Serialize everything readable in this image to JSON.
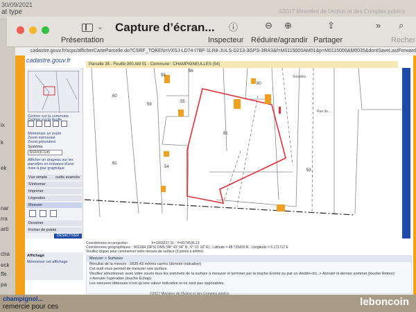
{
  "background": {
    "top_left_text": "30/09/2021",
    "top_left_text2": "at type",
    "top_right_text": "©2017 Ministère de l'Action et des Comptes publics",
    "left_strip_fragments": [
      "ix",
      "k",
      "ek",
      "nar",
      "rra",
      "arti",
      "cha",
      "eck",
      "ffe",
      "pa"
    ],
    "bottom_text": "remercie pour ces",
    "bottom_bold": "champignol..."
  },
  "watermark": "leboncoin",
  "window": {
    "title": "Capture d’écran...",
    "toolbar": {
      "presentation": "Présentation",
      "inspecteur": "Inspecteur",
      "reduire": "Réduire/agrandir",
      "partager": "Partager",
      "recherche": "Recherc"
    }
  },
  "browser": {
    "url": "cadastre.gouv.fr/scpc/afficherCarteParcelle.do?CSRF_TOKEN=VXSJ-LD74-I7BF-1LR8-JULS-D213-3GPS-3RA3&f=M0115000AM01&p=M0115000AM0035&dontSaveLastForward&keep"
  },
  "site": {
    "logo": "cadastre.gouv.fr",
    "parcel_header": "Parcelle 35 - Feuille 000 AM 01 - Commune : CHAMPIGNEULLES (54)",
    "left_panel": {
      "links": [
        "Centrer sur la commune",
        "Centrer sur la feuille"
      ],
      "zoom_links": [
        "Mémoriser ce zoom",
        "Zoom mémorisé",
        "Zoom précédent"
      ],
      "system_label": "Système",
      "system_value": "RGF93CC49",
      "checkbox_label": "Afficher un drapeau sur les parcelles en instance d'une mise à jour graphique",
      "vue_label": "Vue simple",
      "vue_right": "outils avancés",
      "sections": [
        "S'informer",
        "Imprimer",
        "Légendes",
        "Mesurer",
        "Dessiner",
        "Fichier de points"
      ],
      "desactiver": "DÉSACTIVER",
      "affichage": "Affichage",
      "affichage_link": "Mémoriser cet affichage"
    },
    "map_labels": [
      "58",
      "56",
      "60",
      "59",
      "55",
      "80",
      "81",
      "61",
      "54",
      "53",
      "Soualieu",
      "Rue de..."
    ],
    "coords": {
      "line1": "Coordonnées en projection :",
      "line1_val": "X=1933237.31 ; Y=8174106.13",
      "line2": "Coordonnées géographiques :",
      "line2_sys": "WGS84 (GPS)",
      "line2_val": "DMS (48° 43' 34\" N ; 6° 10' 18\" E) ; Latitude = 48.725430 N ; Longitude = 6.171717 E",
      "hint": "Veuillez cliquer pour commencer votre mesure de surface (3 points à définir)"
    },
    "mesure": {
      "title": "Mesurer > Surfaces",
      "result": "Résultat de la mesure : 5839.43 mètres carrés (donnée indicative)",
      "l1": "Cet outil vous permet de mesurer une surface.",
      "l2": "Veuillez sélectionner avec votre souris tous les sommets de la surface à mesurer et terminer par la touche Entrée ou par un double-clic. > Annuler le dernier sommet (touche Retour)",
      "l3": "> Annuler l'opération (touche Échap)",
      "l4": "Les mesures obtenues n'ont qu'une valeur indicative et ne sont pas opposables."
    },
    "footer": "©2017 Ministère de l'Action et des Comptes publics"
  },
  "colors": {
    "frame_orange": "#f1a21a",
    "measure_red": "#e0313a",
    "building_orange": "#f0a020",
    "blue_strip": "#1c4aa6"
  }
}
